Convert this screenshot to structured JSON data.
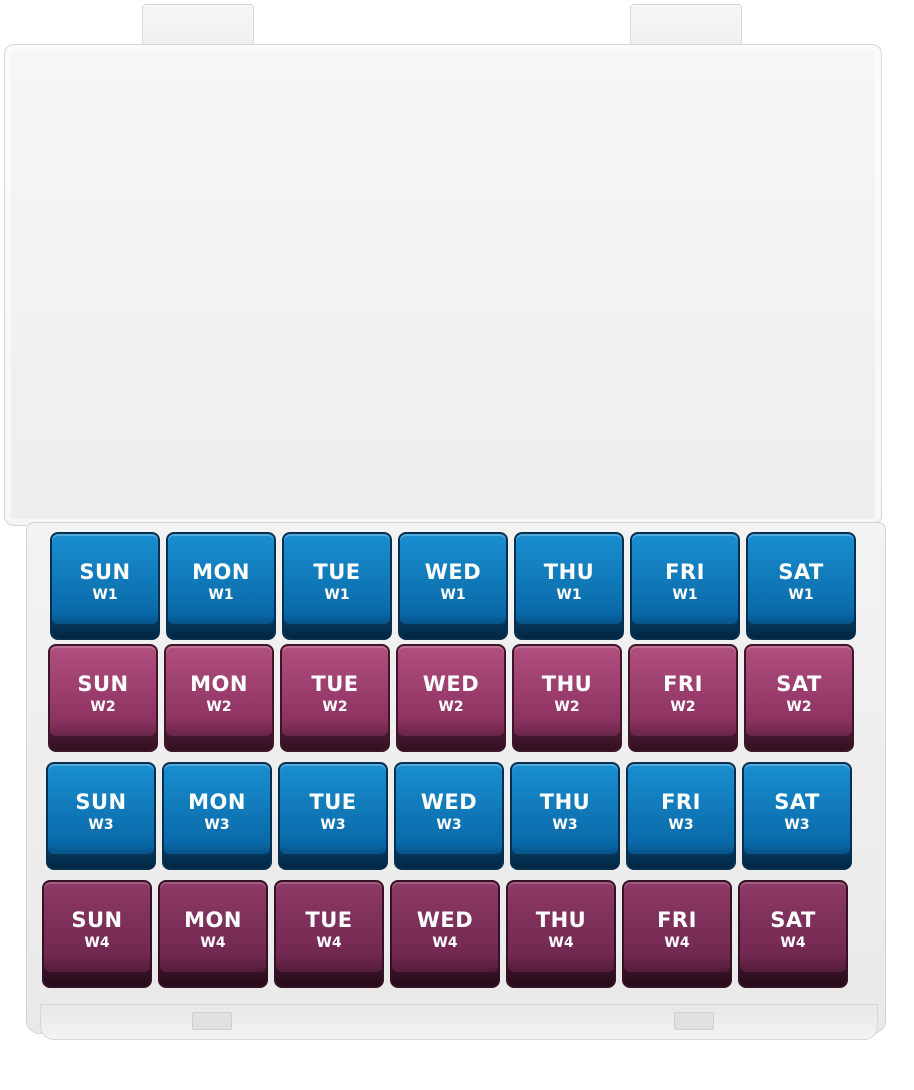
{
  "case": {
    "lid_color": "#f2f2f2",
    "colors": {
      "blue": "#0a6aa9",
      "pink": "#9c3f6e",
      "plum": "#712850"
    }
  },
  "rows": [
    {
      "week": "W1",
      "color": "blue",
      "days": [
        "SUN",
        "MON",
        "TUE",
        "WED",
        "THU",
        "FRI",
        "SAT"
      ]
    },
    {
      "week": "W2",
      "color": "pink",
      "days": [
        "SUN",
        "MON",
        "TUE",
        "WED",
        "THU",
        "FRI",
        "SAT"
      ]
    },
    {
      "week": "W3",
      "color": "blue",
      "days": [
        "SUN",
        "MON",
        "TUE",
        "WED",
        "THU",
        "FRI",
        "SAT"
      ]
    },
    {
      "week": "W4",
      "color": "plum",
      "days": [
        "SUN",
        "MON",
        "TUE",
        "WED",
        "THU",
        "FRI",
        "SAT"
      ]
    }
  ]
}
